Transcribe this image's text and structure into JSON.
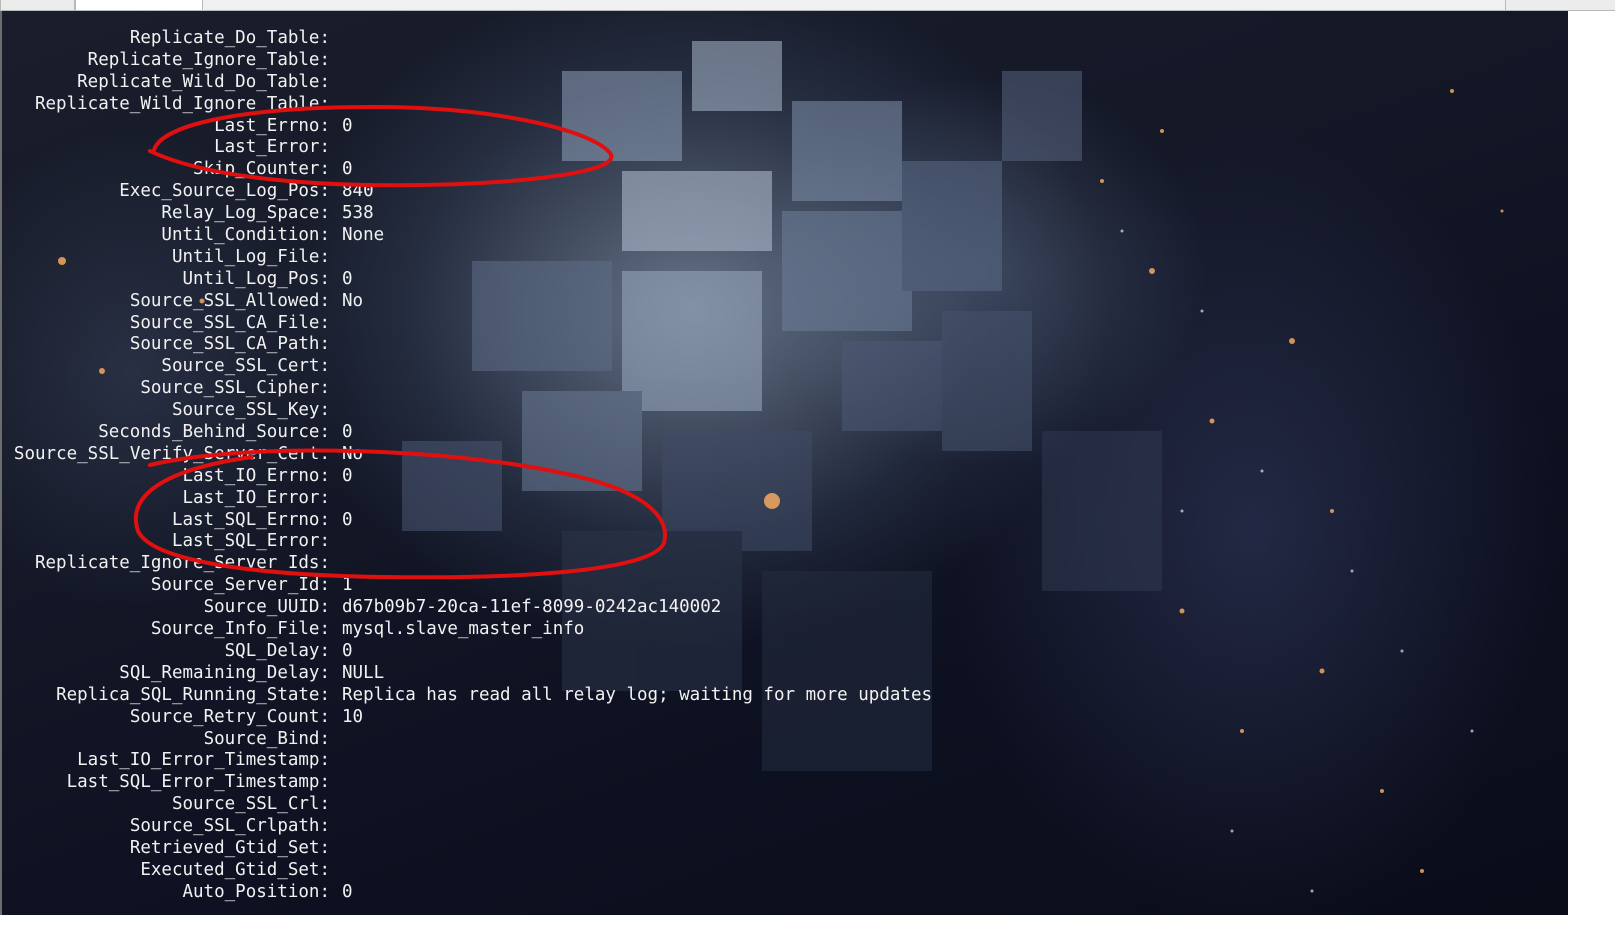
{
  "terminal": {
    "rows": [
      {
        "key": "Replicate_Do_Table:",
        "value": ""
      },
      {
        "key": "Replicate_Ignore_Table:",
        "value": ""
      },
      {
        "key": "Replicate_Wild_Do_Table:",
        "value": ""
      },
      {
        "key": "Replicate_Wild_Ignore_Table:",
        "value": ""
      },
      {
        "key": "Last_Errno:",
        "value": "0"
      },
      {
        "key": "Last_Error:",
        "value": ""
      },
      {
        "key": "Skip_Counter:",
        "value": "0"
      },
      {
        "key": "Exec_Source_Log_Pos:",
        "value": "840"
      },
      {
        "key": "Relay_Log_Space:",
        "value": "538"
      },
      {
        "key": "Until_Condition:",
        "value": "None"
      },
      {
        "key": "Until_Log_File:",
        "value": ""
      },
      {
        "key": "Until_Log_Pos:",
        "value": "0"
      },
      {
        "key": "Source_SSL_Allowed:",
        "value": "No"
      },
      {
        "key": "Source_SSL_CA_File:",
        "value": ""
      },
      {
        "key": "Source_SSL_CA_Path:",
        "value": ""
      },
      {
        "key": "Source_SSL_Cert:",
        "value": ""
      },
      {
        "key": "Source_SSL_Cipher:",
        "value": ""
      },
      {
        "key": "Source_SSL_Key:",
        "value": ""
      },
      {
        "key": "Seconds_Behind_Source:",
        "value": "0"
      },
      {
        "key": "Source_SSL_Verify_Server_Cert:",
        "value": "No"
      },
      {
        "key": "Last_IO_Errno:",
        "value": "0"
      },
      {
        "key": "Last_IO_Error:",
        "value": ""
      },
      {
        "key": "Last_SQL_Errno:",
        "value": "0"
      },
      {
        "key": "Last_SQL_Error:",
        "value": ""
      },
      {
        "key": "Replicate_Ignore_Server_Ids:",
        "value": ""
      },
      {
        "key": "Source_Server_Id:",
        "value": "1"
      },
      {
        "key": "Source_UUID:",
        "value": "d67b09b7-20ca-11ef-8099-0242ac140002"
      },
      {
        "key": "Source_Info_File:",
        "value": "mysql.slave_master_info"
      },
      {
        "key": "SQL_Delay:",
        "value": "0"
      },
      {
        "key": "SQL_Remaining_Delay:",
        "value": "NULL"
      },
      {
        "key": "Replica_SQL_Running_State:",
        "value": "Replica has read all relay log; waiting for more updates"
      },
      {
        "key": "Source_Retry_Count:",
        "value": "10"
      },
      {
        "key": "Source_Bind:",
        "value": ""
      },
      {
        "key": "Last_IO_Error_Timestamp:",
        "value": ""
      },
      {
        "key": "Last_SQL_Error_Timestamp:",
        "value": ""
      },
      {
        "key": "Source_SSL_Crl:",
        "value": ""
      },
      {
        "key": "Source_SSL_Crlpath:",
        "value": ""
      },
      {
        "key": "Retrieved_Gtid_Set:",
        "value": ""
      },
      {
        "key": "Executed_Gtid_Set:",
        "value": ""
      },
      {
        "key": "Auto_Position:",
        "value": "0"
      }
    ]
  },
  "colors": {
    "text": "#f2f2f2",
    "annotation": "#e01010",
    "terminal_bg": "#141827"
  }
}
